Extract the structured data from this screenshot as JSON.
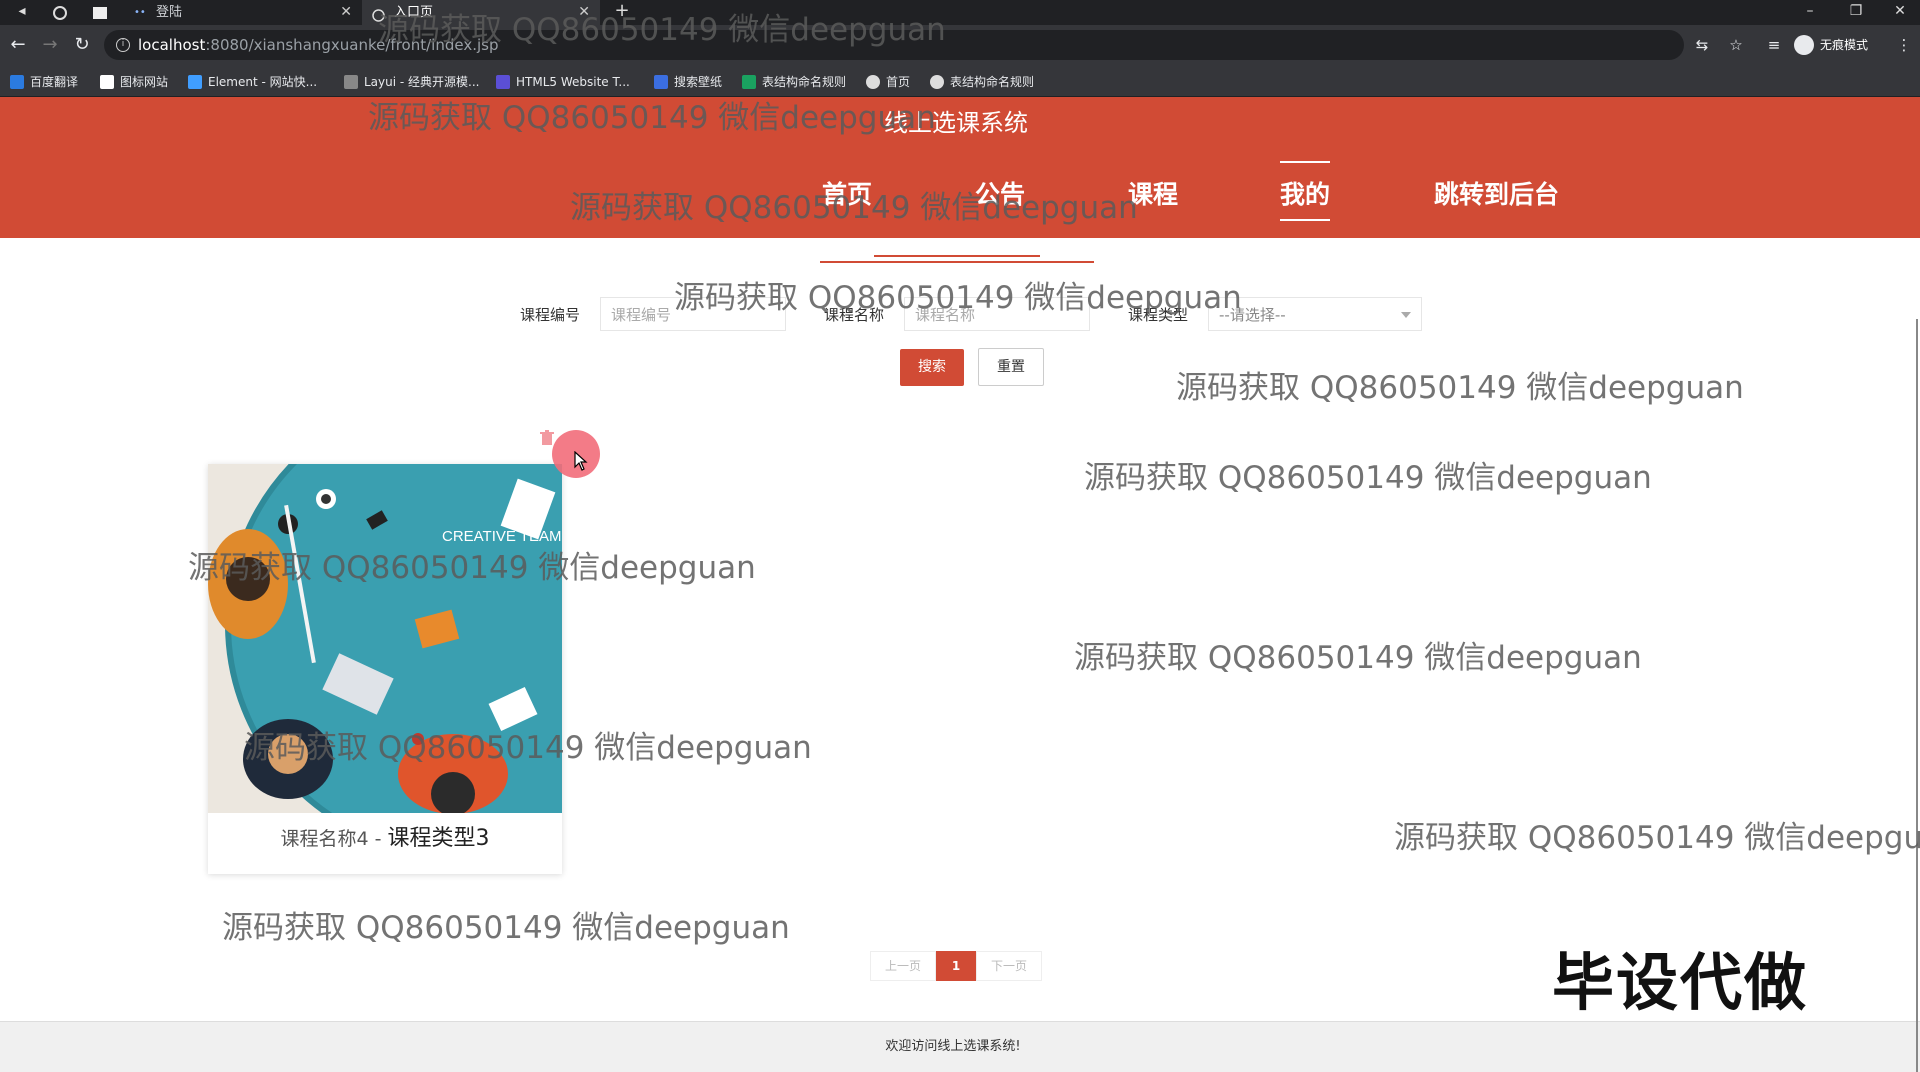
{
  "browser": {
    "tabs": [
      {
        "title": "登陆",
        "active": false
      },
      {
        "title": "入口页",
        "active": true
      }
    ],
    "new_tab_icon": "plus-icon",
    "url_host": "localhost",
    "url_path": ":8080/xianshangxuanke/front/index.jsp",
    "profile_label": "无痕模式",
    "bookmarks": [
      {
        "label": "百度翻译",
        "color": "#2b7be0"
      },
      {
        "label": "图标网站",
        "color": "#ffffff"
      },
      {
        "label": "Element - 网站快...",
        "color": "#409eff"
      },
      {
        "label": "Layui - 经典开源模...",
        "color": "#888888"
      },
      {
        "label": "HTML5 Website T...",
        "color": "#5b4fd6"
      },
      {
        "label": "搜索壁纸",
        "color": "#3b6ee0"
      },
      {
        "label": "表结构命名规则",
        "color": "#1aa260"
      },
      {
        "label": "首页",
        "color": "#dddddd"
      },
      {
        "label": "表结构命名规则",
        "color": "#dddddd"
      }
    ]
  },
  "site": {
    "title": "线上选课系统",
    "nav": [
      "首页",
      "公告",
      "课程",
      "我的",
      "跳转到后台"
    ],
    "active_nav": "我的",
    "brand_color": "#d14b35"
  },
  "search": {
    "code_label": "课程编号",
    "code_placeholder": "课程编号",
    "name_label": "课程名称",
    "name_placeholder": "课程名称",
    "type_label": "课程类型",
    "type_selected": "--请选择--",
    "search_button": "搜索",
    "reset_button": "重置"
  },
  "courses": [
    {
      "name": "课程名称4",
      "separator": " - ",
      "type": "课程类型3",
      "image_text": "CREATIVE TEAM"
    }
  ],
  "pagination": {
    "prev": "上一页",
    "current": "1",
    "next": "下一页"
  },
  "footer": {
    "text": "欢迎访问线上选课系统!"
  },
  "overlay": {
    "watermark": "源码获取 QQ86050149 微信deepguan",
    "stamp": "毕设代做"
  }
}
